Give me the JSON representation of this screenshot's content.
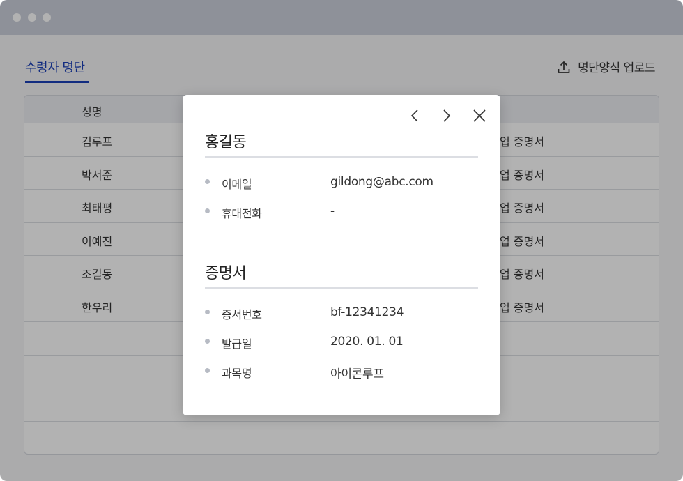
{
  "page": {
    "tab_label": "수령자 명단",
    "upload_label": "명단양식 업로드",
    "table": {
      "header_name": "성명",
      "rows": [
        {
          "name": "김루프",
          "cert": "업 증명서"
        },
        {
          "name": "박서준",
          "cert": "업 증명서"
        },
        {
          "name": "최태평",
          "cert": "업 증명서"
        },
        {
          "name": "이예진",
          "cert": "업 증명서"
        },
        {
          "name": "조길동",
          "cert": "업 증명서"
        },
        {
          "name": "한우리",
          "cert": "업 증명서"
        }
      ]
    }
  },
  "modal": {
    "person_name": "홍길동",
    "contact_fields": [
      {
        "label": "이메일",
        "value": "gildong@abc.com"
      },
      {
        "label": "휴대전화",
        "value": "-"
      }
    ],
    "cert_section_title": "증명서",
    "cert_fields": [
      {
        "label": "증서번호",
        "value": "bf-12341234"
      },
      {
        "label": "발급일",
        "value": "2020. 01. 01"
      },
      {
        "label": "과목명",
        "value": "아이콘루프"
      }
    ]
  },
  "icons": {
    "upload": "upload-icon",
    "prev": "chevron-left-icon",
    "next": "chevron-right-icon",
    "close": "close-icon"
  },
  "colors": {
    "accent": "#1a3fb8",
    "titlebar": "#ccd0dc",
    "overlay": "rgba(0,0,0,0.30)"
  }
}
